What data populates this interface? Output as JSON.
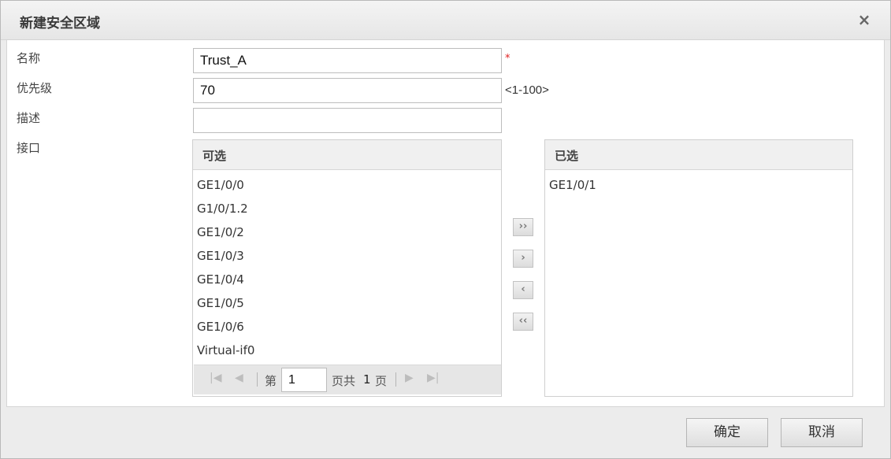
{
  "dialog": {
    "title": "新建安全区域",
    "close_glyph": "×"
  },
  "form": {
    "name_label": "名称",
    "name_value": "Trust_A",
    "required_mark": "*",
    "priority_label": "优先级",
    "priority_value": "70",
    "priority_hint": "<1-100>",
    "desc_label": "描述",
    "desc_value": "",
    "iface_label": "接口"
  },
  "available": {
    "header": "可选",
    "items": [
      "GE1/0/0",
      "G1/0/1.2",
      "GE1/0/2",
      "GE1/0/3",
      "GE1/0/4",
      "GE1/0/5",
      "GE1/0/6",
      "Virtual-if0"
    ]
  },
  "pager": {
    "prefix": "第",
    "page_value": "1",
    "suffix": "页共",
    "total": "1",
    "suffix2": "页"
  },
  "move_buttons": {
    "add_all": "››",
    "add": "›",
    "remove": "‹",
    "remove_all": "‹‹"
  },
  "selected": {
    "header": "已选",
    "items": [
      "GE1/0/1"
    ]
  },
  "footer": {
    "ok_label": "确定",
    "cancel_label": "取消"
  }
}
